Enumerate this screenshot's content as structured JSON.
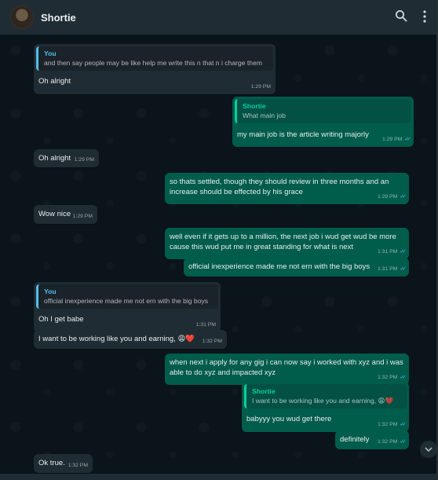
{
  "header": {
    "contact_name": "Shortie"
  },
  "icons": {
    "search": "search-icon",
    "menu": "kebab-menu-icon",
    "scroll_down": "chevron-down-icon",
    "read_receipt": "double-check-icon"
  },
  "colors": {
    "incoming_bubble": "#202c33",
    "outgoing_bubble": "#005c4b",
    "read_ticks": "#53bdeb",
    "quote_author_in": "#53bdeb",
    "quote_author_out": "#06cf9c"
  },
  "messages": [
    {
      "dir": "in",
      "quote_author": "You",
      "quote_text": "and then say people may be like help me write this n that n i charge them",
      "text": "Oh alright",
      "time": "1:29 PM"
    },
    {
      "dir": "out",
      "quote_author": "Shortie",
      "quote_text": "What main job",
      "text": "my main job is the article writing majorly",
      "time": "1:29 PM"
    },
    {
      "dir": "in",
      "text": "Oh alright",
      "time": "1:29 PM"
    },
    {
      "dir": "out",
      "text": "so thats settled, though they should review in three months and an increase should be effected by his grace",
      "time": "1:29 PM"
    },
    {
      "dir": "in",
      "text": "Wow nice",
      "time": "1:29 PM"
    },
    {
      "dir": "out",
      "text": "well even if it gets up to a million, the next job i wud get wud be more cause this wud put me in great standing for what is next",
      "time": "1:31 PM"
    },
    {
      "dir": "out",
      "text": "official inexperience made me not ern with the big boys",
      "time": "1:31 PM"
    },
    {
      "dir": "in",
      "quote_author": "You",
      "quote_text": "official inexperience made me not ern with the big boys",
      "text": "Oh I get babe",
      "time": "1:31 PM"
    },
    {
      "dir": "in",
      "text": "I want to be working like you and earning, 😩❤️",
      "time": "1:32 PM"
    },
    {
      "dir": "out",
      "text": "when next i apply for any gig i can now say i worked with xyz and i was able to do xyz and impacted xyz",
      "time": "1:32 PM"
    },
    {
      "dir": "out",
      "quote_author": "Shortie",
      "quote_text": "I want to be working like you and earning, 😩❤️",
      "text": "babyyy you wud get there",
      "time": "1:32 PM"
    },
    {
      "dir": "out",
      "text": "definitely",
      "time": "1:32 PM"
    },
    {
      "dir": "in",
      "text": "Ok true.",
      "time": "1:32 PM"
    }
  ]
}
